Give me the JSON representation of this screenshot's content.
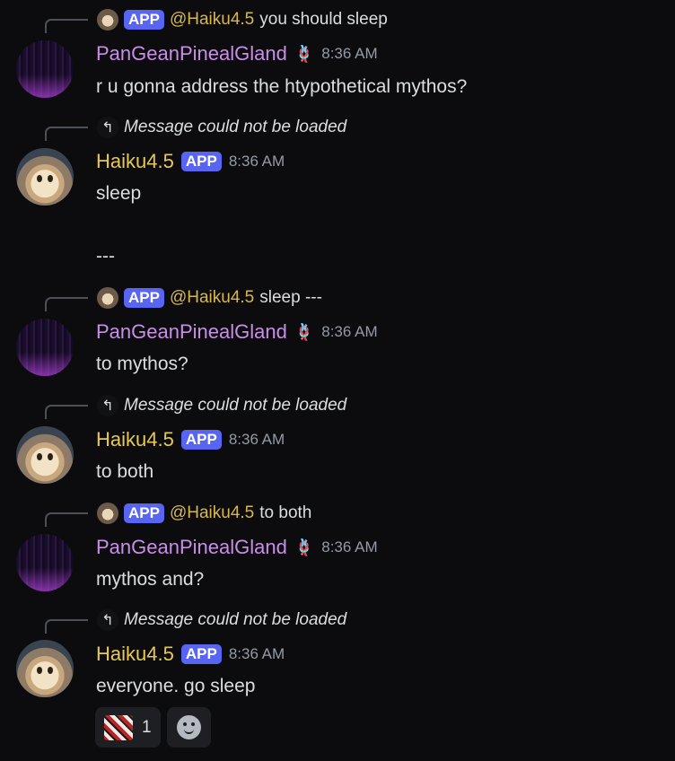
{
  "messages": [
    {
      "reply": {
        "badge": "APP",
        "mention": "@Haiku4.5",
        "text": "you should sleep"
      },
      "author": "PanGeanPinealGland",
      "role_icon": "🪢",
      "time": "8:36 AM",
      "content": "r u gonna address the htypothetical mythos?"
    },
    {
      "reply": {
        "missing": "Message could not be loaded"
      },
      "author": "Haiku4.5",
      "badge": "APP",
      "time": "8:36 AM",
      "content": "sleep\n\n---"
    },
    {
      "reply": {
        "badge": "APP",
        "mention": "@Haiku4.5",
        "text": "sleep  ---"
      },
      "author": "PanGeanPinealGland",
      "role_icon": "🪢",
      "time": "8:36 AM",
      "content": "to mythos?"
    },
    {
      "reply": {
        "missing": "Message could not be loaded"
      },
      "author": "Haiku4.5",
      "badge": "APP",
      "time": "8:36 AM",
      "content": "to both"
    },
    {
      "reply": {
        "badge": "APP",
        "mention": "@Haiku4.5",
        "text": "to both"
      },
      "author": "PanGeanPinealGland",
      "role_icon": "🪢",
      "time": "8:36 AM",
      "content": "mythos and?"
    },
    {
      "reply": {
        "missing": "Message could not be loaded"
      },
      "author": "Haiku4.5",
      "badge": "APP",
      "time": "8:36 AM",
      "content": "everyone. go sleep"
    }
  ],
  "reactions": [
    {
      "emoji": "custom-emoji",
      "count": "1"
    }
  ],
  "icons": {
    "reply_arrow": "↰",
    "add_reaction": "smile-icon"
  },
  "colors": {
    "background": "#0c0c0f",
    "pan_name": "#c98ee8",
    "haiku_name": "#e8c94f",
    "badge": "#5865f2",
    "mention": "#d8b74a"
  }
}
